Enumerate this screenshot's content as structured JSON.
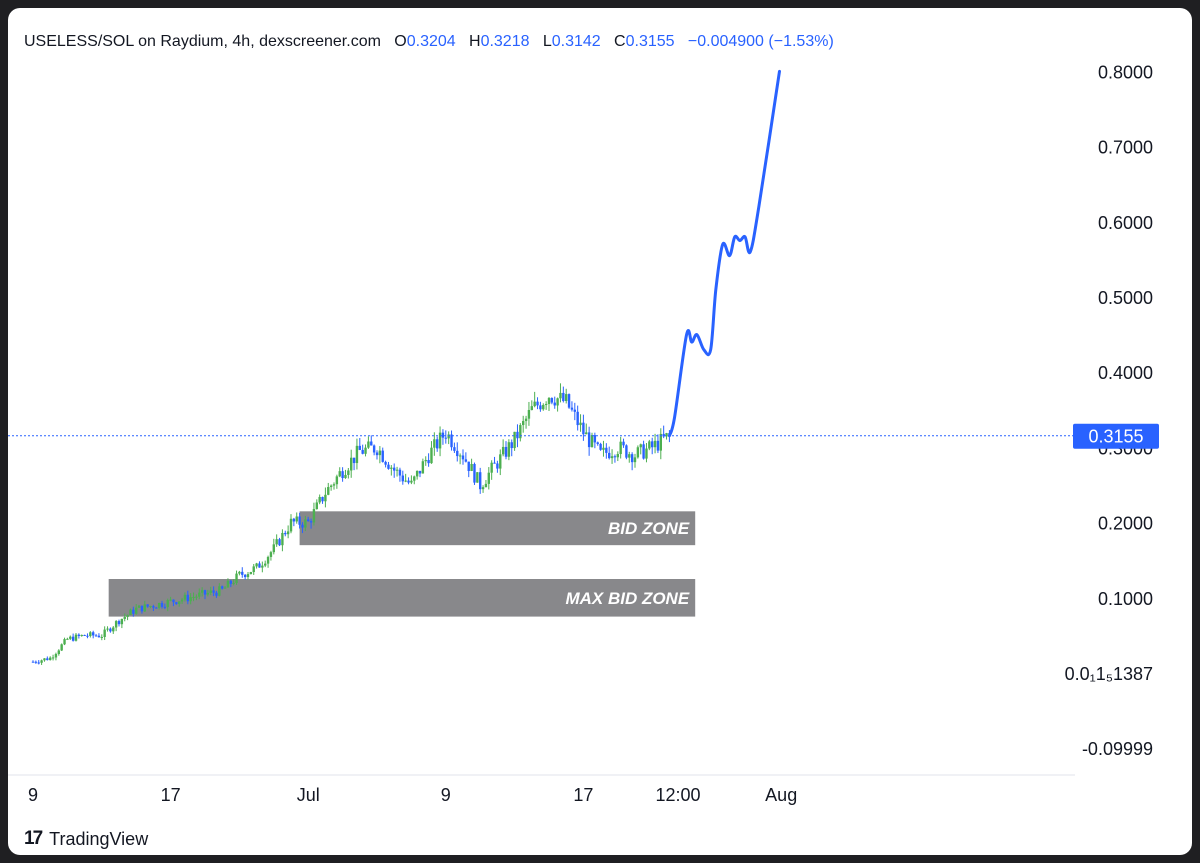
{
  "header": {
    "symbol": "USELESS/SOL on Raydium, 4h, dexscreener.com",
    "o_label": "O",
    "o_value": "0.3204",
    "h_label": "H",
    "h_value": "0.3218",
    "l_label": "L",
    "l_value": "0.3142",
    "c_label": "C",
    "c_value": "0.3155",
    "change": "−0.004900 (−1.53%)"
  },
  "branding": {
    "logo_text": "17",
    "name": "TradingView"
  },
  "colors": {
    "up": "#4caf50",
    "down": "#2962ff",
    "projection": "#2962ff",
    "zone": "#88888b",
    "price_line": "#2962ff",
    "price_tag": "#2962ff"
  },
  "chart_data": {
    "type": "candlestick",
    "title": "USELESS/SOL on Raydium, 4h, dexscreener.com",
    "last_price": 0.3155,
    "last_price_label": "0.3155",
    "y_ticks": [
      0.8,
      0.7,
      0.6,
      0.5,
      0.4,
      0.3,
      0.2,
      0.1,
      0.0,
      -0.1
    ],
    "y_tick_labels": [
      "0.8000",
      "0.7000",
      "0.6000",
      "0.5000",
      "0.4000",
      "0.3000",
      "0.2000",
      "0.1000",
      "0.0₁1₅1387",
      "-0.09999"
    ],
    "x_tick_labels": [
      "9",
      "17",
      "Jul",
      "9",
      "17",
      "12:00",
      "Aug"
    ],
    "x_tick_days": [
      0,
      8,
      16,
      24,
      32,
      37.5,
      43.5
    ],
    "zones": [
      {
        "label": "BID ZONE",
        "x_start_day": 15.5,
        "x_end_day": 38.5,
        "y_low": 0.17,
        "y_high": 0.215
      },
      {
        "label": "MAX BID ZONE",
        "x_start_day": 4.4,
        "x_end_day": 38.5,
        "y_low": 0.075,
        "y_high": 0.125
      }
    ],
    "price_path": [
      [
        0,
        0.015
      ],
      [
        1,
        0.02
      ],
      [
        2,
        0.045
      ],
      [
        3,
        0.05
      ],
      [
        4,
        0.05
      ],
      [
        5,
        0.07
      ],
      [
        6,
        0.085
      ],
      [
        7,
        0.09
      ],
      [
        8,
        0.095
      ],
      [
        9,
        0.1
      ],
      [
        10,
        0.105
      ],
      [
        11,
        0.11
      ],
      [
        12,
        0.13
      ],
      [
        13,
        0.14
      ],
      [
        14,
        0.165
      ],
      [
        15,
        0.2
      ],
      [
        16,
        0.2
      ],
      [
        17,
        0.24
      ],
      [
        18,
        0.27
      ],
      [
        19,
        0.295
      ],
      [
        20,
        0.3
      ],
      [
        21,
        0.27
      ],
      [
        22,
        0.25
      ],
      [
        23,
        0.29
      ],
      [
        24,
        0.32
      ],
      [
        25,
        0.29
      ],
      [
        26,
        0.25
      ],
      [
        27,
        0.28
      ],
      [
        28,
        0.31
      ],
      [
        29,
        0.35
      ],
      [
        30,
        0.37
      ],
      [
        31,
        0.36
      ],
      [
        32,
        0.32
      ],
      [
        33,
        0.29
      ],
      [
        34,
        0.3
      ],
      [
        35,
        0.29
      ],
      [
        36,
        0.3
      ],
      [
        37,
        0.3155
      ]
    ],
    "projection": [
      [
        37,
        0.3155
      ],
      [
        37.3,
        0.34
      ],
      [
        38,
        0.45
      ],
      [
        38.3,
        0.44
      ],
      [
        38.6,
        0.45
      ],
      [
        39,
        0.43
      ],
      [
        39.4,
        0.43
      ],
      [
        39.7,
        0.51
      ],
      [
        40.1,
        0.57
      ],
      [
        40.5,
        0.555
      ],
      [
        40.8,
        0.58
      ],
      [
        41.1,
        0.575
      ],
      [
        41.4,
        0.58
      ],
      [
        41.7,
        0.56
      ],
      [
        42.2,
        0.62
      ],
      [
        43.4,
        0.8
      ]
    ]
  }
}
